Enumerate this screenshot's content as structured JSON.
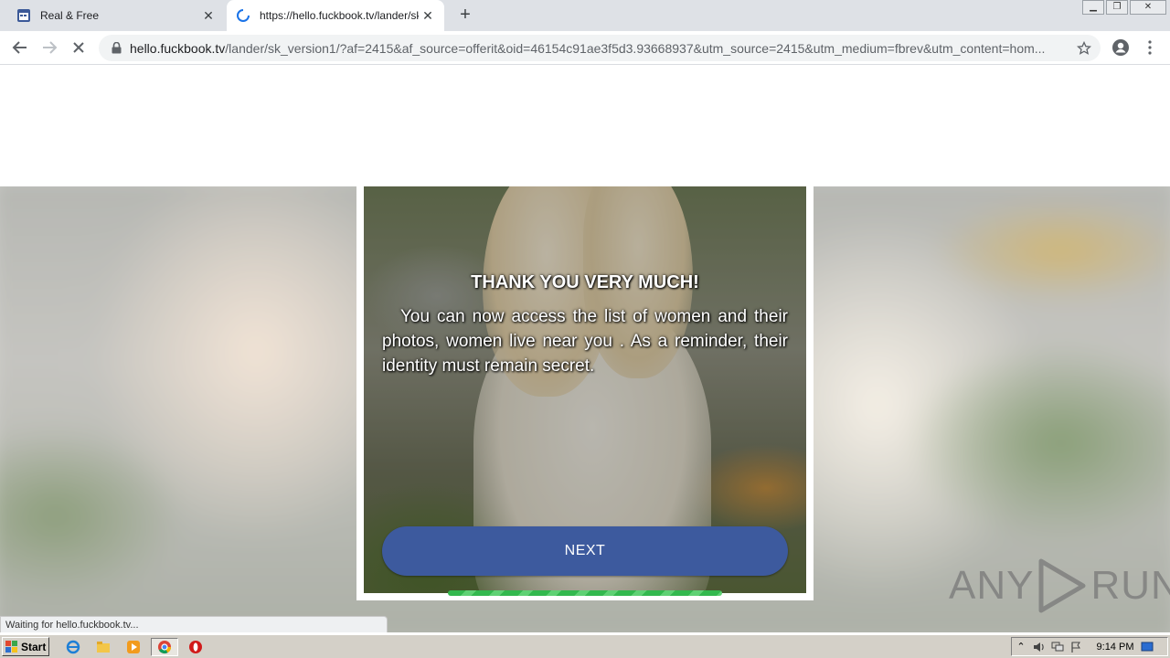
{
  "browser": {
    "tabs": [
      {
        "title": "Real & Free",
        "favicon": "calendar-icon",
        "active": false
      },
      {
        "title": "https://hello.fuckbook.tv/lander/sk_",
        "favicon": "loading-spinner-icon",
        "active": true
      }
    ],
    "url_host": "hello.fuckbook.tv",
    "url_rest": "/lander/sk_version1/?af=2415&af_source=offerit&oid=46154c91ae3f5d3.93668937&utm_source=2415&utm_medium=fbrev&utm_content=hom...",
    "status_text": "Waiting for hello.fuckbook.tv..."
  },
  "page": {
    "heading": "THANK YOU VERY MUCH!",
    "body": "You can now access the list of women and their photos, women live near you . As a reminder, their identity must remain secret.",
    "next_label": "NEXT",
    "progress_fraction": 1.0
  },
  "watermark": {
    "left": "ANY",
    "right": "RUN"
  },
  "taskbar": {
    "start_label": "Start",
    "clock": "9:14 PM"
  },
  "colors": {
    "button": "#3d5a9e",
    "progress": "#33b84e",
    "taskbar": "#d4d0c8"
  }
}
